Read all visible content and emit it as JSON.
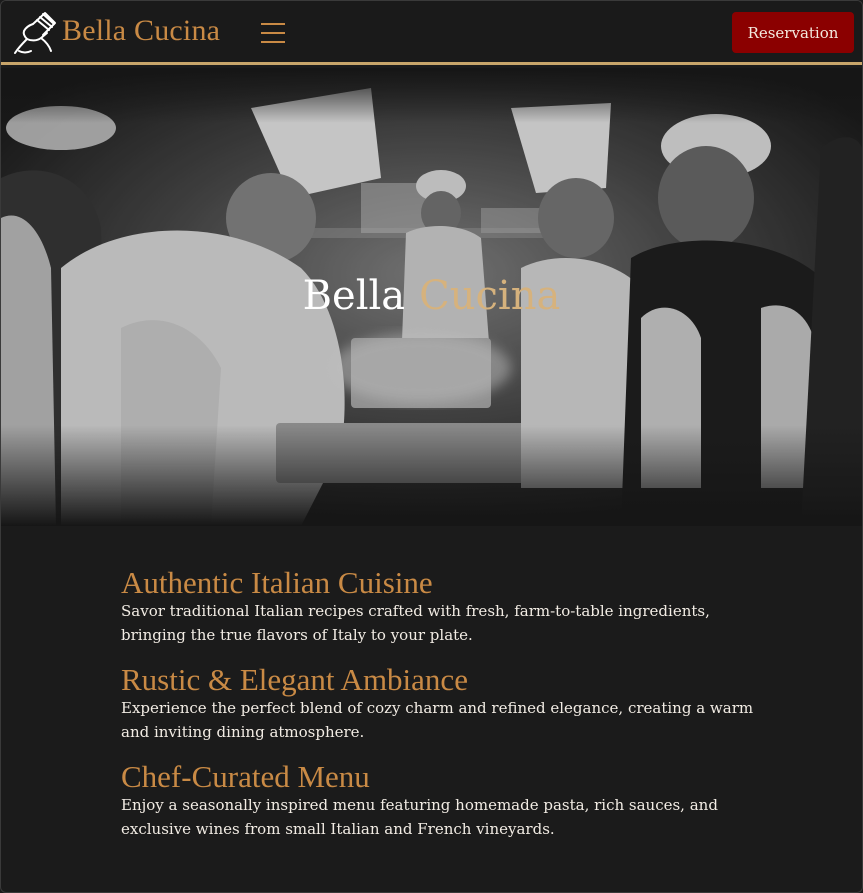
{
  "navbar": {
    "brand": "Bella Cucina",
    "reservation_label": "Reservation",
    "accent_color": "#c8a56a",
    "button_color": "#8b0000"
  },
  "hero": {
    "title_word1": "Bella",
    "title_word2": "Cucina"
  },
  "features": [
    {
      "title": "Authentic Italian Cuisine",
      "text": "Savor traditional Italian recipes crafted with fresh, farm-to-table ingredients, bringing the true flavors of Italy to your plate."
    },
    {
      "title": "Rustic & Elegant Ambiance",
      "text": "Experience the perfect blend of cozy charm and refined elegance, creating a warm and inviting dining atmosphere."
    },
    {
      "title": "Chef-Curated Menu",
      "text": "Enjoy a seasonally inspired menu featuring homemade pasta, rich sauces, and exclusive wines from small Italian and French vineyards."
    }
  ]
}
